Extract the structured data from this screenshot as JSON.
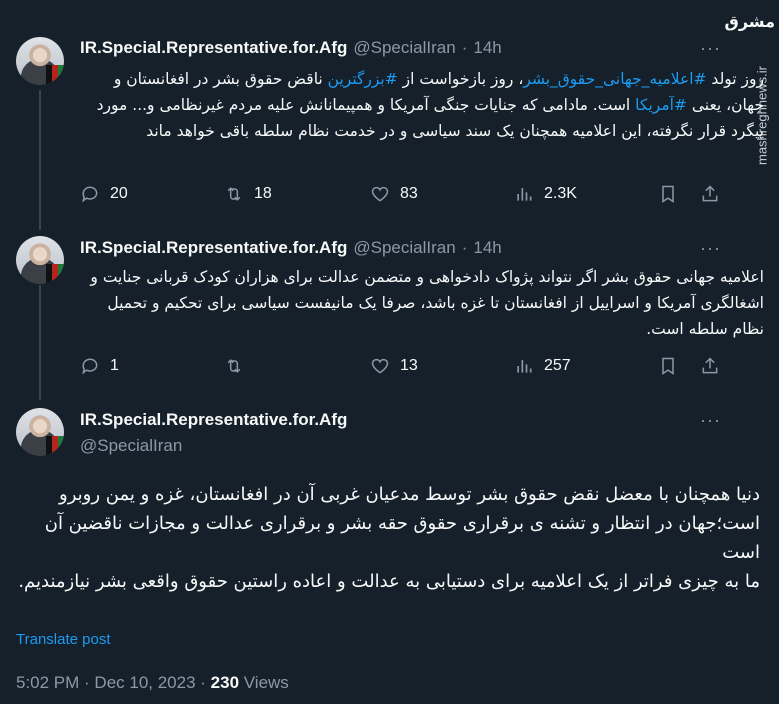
{
  "watermark": {
    "logo": "مشرق",
    "url": "mashreghnews.ir"
  },
  "author": {
    "name": "IR.Special.Representative.for.Afg",
    "handle": "@SpecialIran"
  },
  "tweets": [
    {
      "time": "14h",
      "text_parts": [
        {
          "t": "روز تولد ",
          "hl": false
        },
        {
          "t": "#اعلامیه_جهانی_حقوق_بشر",
          "hl": true
        },
        {
          "t": "، روز بازخواست از ",
          "hl": false
        },
        {
          "t": "#بزرگترین",
          "hl": true
        },
        {
          "t": " ناقض حقوق بشر در افغانستان و جهان، یعنی ",
          "hl": false
        },
        {
          "t": "#آمریکا",
          "hl": true
        },
        {
          "t": " است. مادامی که جنایات جنگی آمریکا و همپیمانانش علیه مردم غیرنظامی و... مورد پیگرد قرار نگرفته، این اعلامیه همچنان یک سند سیاسی و در خدمت نظام سلطه باقی خواهد ماند",
          "hl": false
        }
      ],
      "replies": "20",
      "reposts": "18",
      "likes": "83",
      "views": "2.3K"
    },
    {
      "time": "14h",
      "text": "اعلامیه جهانی حقوق بشر اگر نتواند پژواک دادخواهی و متضمن عدالت برای هزاران کودک قربانی جنایت و اشغالگری آمریکا و اسراییل از افغانستان تا غزه باشد، صرفا یک مانیفست سیاسی برای تحکیم و تحمیل نظام سلطه است.",
      "replies": "1",
      "reposts": "",
      "likes": "13",
      "views": "257"
    }
  ],
  "main": {
    "text": "دنیا همچنان با معضل نقض حقوق بشر توسط مدعیان  غربی آن در افغانستان، غزه و یمن روبرو است؛جهان در انتظار و تشنه ی برقراری حقوق حقه بشر و برقراری عدالت و مجازات ناقضین آن است\nما به چیزی فراتر از یک اعلامیه برای دستیابی به عدالت و اعاده راستین حقوق واقعی بشر نیازمندیم.",
    "translate": "Translate post",
    "timestamp": "5:02 PM · Dec 10, 2023 · ",
    "views_count": "230",
    "views_label": " Views"
  },
  "ui": {
    "dot": "·",
    "more": "···"
  },
  "colors": {
    "background": "#15202b",
    "accent": "#1d9bf0",
    "muted": "#8b98a5"
  },
  "icons": [
    "reply-icon",
    "repost-icon",
    "like-icon",
    "views-icon",
    "bookmark-icon",
    "share-icon",
    "more-icon"
  ]
}
